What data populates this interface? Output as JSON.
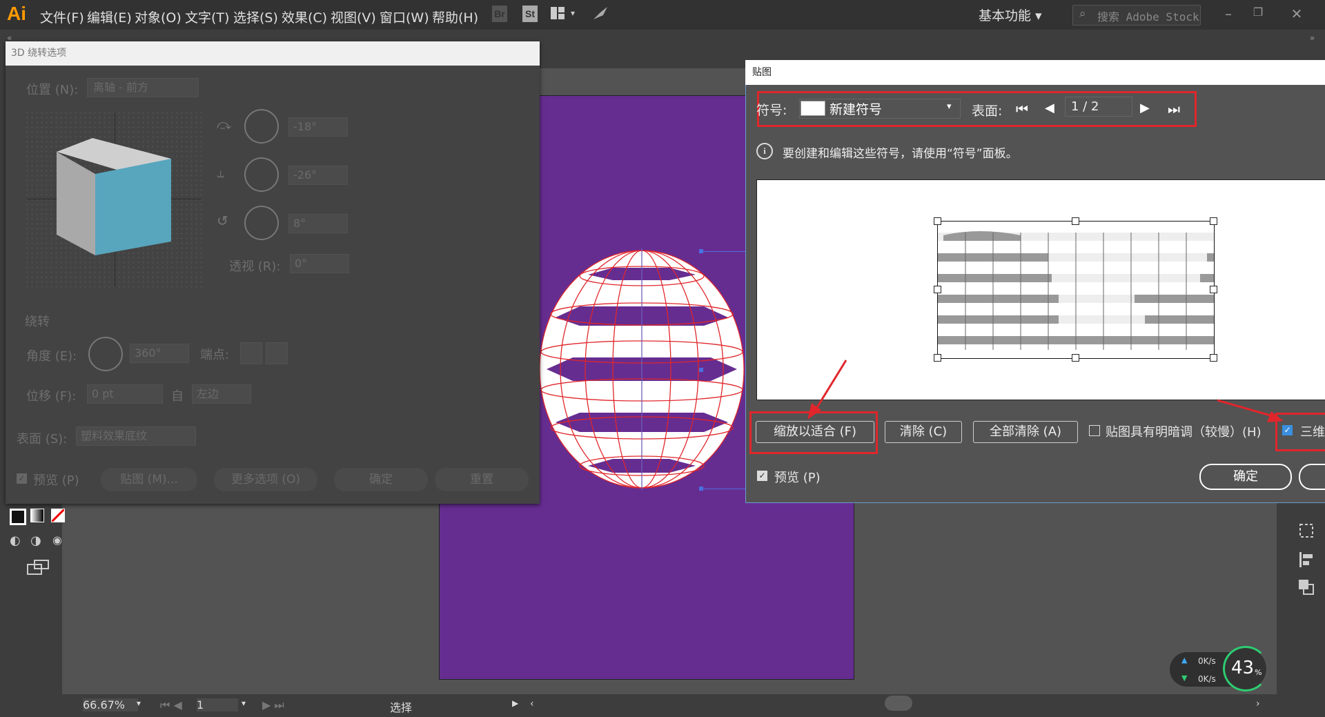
{
  "app": {
    "logo": "Ai",
    "menu": [
      "文件(F)",
      "编辑(E)",
      "对象(O)",
      "文字(T)",
      "选择(S)",
      "效果(C)",
      "视图(V)",
      "窗口(W)",
      "帮助(H)"
    ],
    "bridge_label": "Br",
    "stock_label": "St",
    "workspace": "基本功能",
    "search_placeholder": "搜索 Adobe Stock",
    "accent": "#ff9a00",
    "artboard_color": "#662d91"
  },
  "status": {
    "zoom": "66.67%",
    "page": "1",
    "tool": "选择"
  },
  "dialog3d": {
    "title": "3D 绕转选项",
    "position_label": "位置 (N):",
    "position_value": "离轴 - 前方",
    "rot_x": "-18°",
    "rot_y": "-26°",
    "rot_z": "8°",
    "perspective_label": "透视 (R):",
    "perspective_value": "0°",
    "revolve_section": "绕转",
    "angle_label": "角度 (E):",
    "angle_value": "360°",
    "cap_label": "端点:",
    "offset_label": "位移 (F):",
    "offset_value": "0 pt",
    "from_label": "自",
    "from_value": "左边",
    "surface_label": "表面 (S):",
    "surface_value": "塑料效果底纹",
    "preview_label": "预览 (P)",
    "map_button": "贴图 (M)...",
    "more_button": "更多选项 (O)",
    "ok_button": "确定",
    "reset_button": "重置",
    "cube_face_color": "#58a5be"
  },
  "dialogmap": {
    "title": "贴图",
    "symbol_label": "符号:",
    "symbol_value": "新建符号",
    "surface_label": "表面:",
    "surface_value": "1 / 2",
    "info_text": "要创建和编辑这些符号，请使用“符号”面板。",
    "fit_button": "缩放以适合 (F)",
    "clear_button": "清除 (C)",
    "clear_all_button": "全部清除 (A)",
    "shade_label": "贴图具有明暗调（较慢）(H)",
    "invisible_label": "三维",
    "preview_label": "预览 (P)",
    "ok_button": "确定"
  },
  "net": {
    "up": "0K/s",
    "down": "0K/s",
    "percent": "43",
    "percent_unit": "%"
  }
}
